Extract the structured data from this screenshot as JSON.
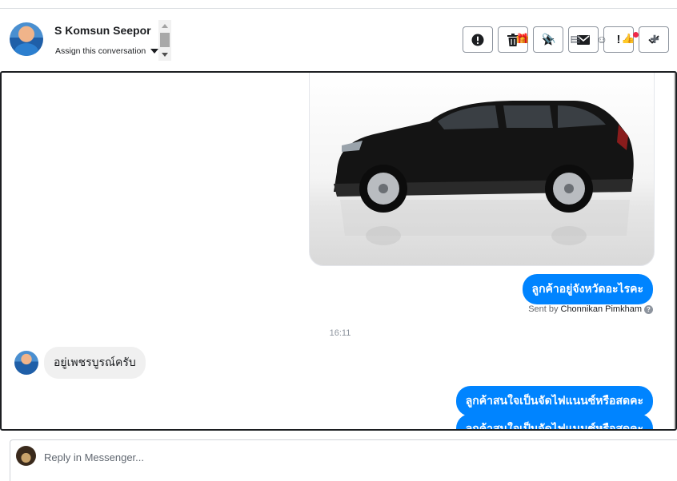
{
  "header": {
    "contact_name": "S Komsun Seepor",
    "assign_label": "Assign this conversation",
    "actions": [
      {
        "name": "mark-spam-button",
        "icon": "alert-circle-icon"
      },
      {
        "name": "delete-button",
        "icon": "trash-icon"
      },
      {
        "name": "star-button",
        "icon": "star-icon"
      },
      {
        "name": "mark-unread-button",
        "icon": "envelope-icon"
      },
      {
        "name": "follow-up-button",
        "icon": "exclamation-icon",
        "glyph": "!"
      },
      {
        "name": "mark-done-button",
        "icon": "checkmark-icon"
      }
    ]
  },
  "messages": {
    "outgoing_1": "ลูกค้าอยู่จังหวัดอะไรคะ",
    "sent_by_prefix": "Sent by",
    "sent_by_agent": "Chonnikan Pimkham",
    "help_glyph": "?",
    "timestamp": "16:11",
    "incoming_1": "อยู่เพชรบูรณ์ครับ",
    "outgoing_2": "ลูกค้าสนใจเป็นจัดไฟแนนซ์หรือสดคะ",
    "outgoing_3": "ลูกค้าสนใจเป็นจัดไฟแนนซ์หรือสดคะ"
  },
  "composer": {
    "placeholder": "Reply in Messenger..."
  },
  "colors": {
    "outgoing_bubble": "#0084ff",
    "incoming_bubble": "#f0f0f0",
    "notification_dot": "#f02849"
  }
}
